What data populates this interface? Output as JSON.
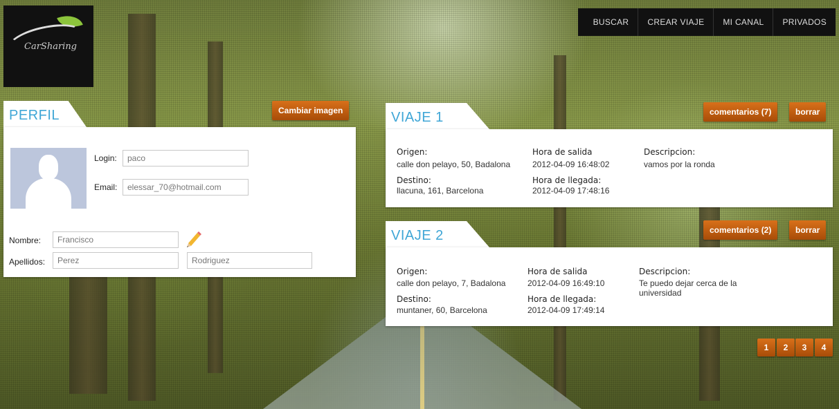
{
  "logo": {
    "brand": "CarSharing"
  },
  "nav": {
    "items": [
      "BUSCAR",
      "CREAR VIAJE",
      "MI CANAL",
      "PRIVADOS"
    ]
  },
  "perfil": {
    "title": "PERFIL",
    "change_image_label": "Cambiar imagen",
    "login_label": "Login:",
    "login_value": "paco",
    "email_label": "Email:",
    "email_value": "elessar_70@hotmail.com",
    "nombre_label": "Nombre:",
    "nombre_value": "Francisco",
    "apellidos_label": "Apellidos:",
    "apellido1_value": "Perez",
    "apellido2_value": "Rodriguez"
  },
  "viajes": [
    {
      "title": "VIAJE 1",
      "comments_label": "comentarios (7)",
      "delete_label": "borrar",
      "origen_label": "Origen:",
      "origen": "calle don pelayo, 50, Badalona",
      "destino_label": "Destino:",
      "destino": "llacuna, 161, Barcelona",
      "salida_label": "Hora de salida",
      "salida": "2012-04-09 16:48:02",
      "llegada_label": "Hora de llegada:",
      "llegada": "2012-04-09 17:48:16",
      "descripcion_label": "Descripcion:",
      "descripcion": "vamos por la ronda"
    },
    {
      "title": "VIAJE 2",
      "comments_label": "comentarios (2)",
      "delete_label": "borrar",
      "origen_label": "Origen:",
      "origen": "calle don pelayo, 7, Badalona",
      "destino_label": "Destino:",
      "destino": "muntaner, 60, Barcelona",
      "salida_label": "Hora de salida",
      "salida": "2012-04-09 16:49:10",
      "llegada_label": "Hora de llegada:",
      "llegada": "2012-04-09 17:49:14",
      "descripcion_label": "Descripcion:",
      "descripcion": "Te puedo dejar cerca de la universidad"
    }
  ],
  "pagination": {
    "pages": [
      "1",
      "2",
      "3",
      "4"
    ]
  },
  "colors": {
    "accent": "#c0600e",
    "tab_text": "#3fa6d6",
    "nav_bg": "#111111"
  }
}
